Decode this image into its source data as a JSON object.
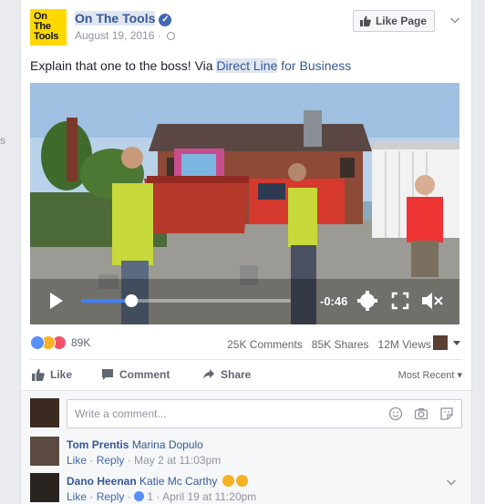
{
  "left_fragment": "s",
  "post": {
    "logo_lines": [
      "On",
      "The",
      "Tools"
    ],
    "page_name": "On The Tools",
    "date": "August 19, 2016",
    "meta_sep": "·",
    "like_page_label": "Like Page",
    "text_prefix": "Explain that one to the boss! Via ",
    "text_link1": "Direct Line",
    "text_link2": " for Business"
  },
  "video": {
    "time_remaining": "-0:46",
    "progress": 0.24
  },
  "stats": {
    "reaction_count": "89K",
    "comments": "25K Comments",
    "shares": "85K Shares",
    "views": "12M Views"
  },
  "actions": {
    "like": "Like",
    "comment": "Comment",
    "share": "Share",
    "most_recent": "Most Recent"
  },
  "composer": {
    "placeholder": "Write a comment..."
  },
  "comments": [
    {
      "author": "Tom Prentis",
      "tag": "Marina Dopulo",
      "like": "Like",
      "reply": "Reply",
      "date": "May 2 at 11:03pm",
      "likes": ""
    },
    {
      "author": "Dano Heenan",
      "tag": "Katie Mc Carthy",
      "like": "Like",
      "reply": "Reply",
      "likes": "1",
      "date": "April 19 at 11:20pm"
    }
  ],
  "sep": "·",
  "colors": {
    "link": "#365899",
    "accent": "#4267b2",
    "love": "#f25268",
    "haha": "#f7b125"
  }
}
